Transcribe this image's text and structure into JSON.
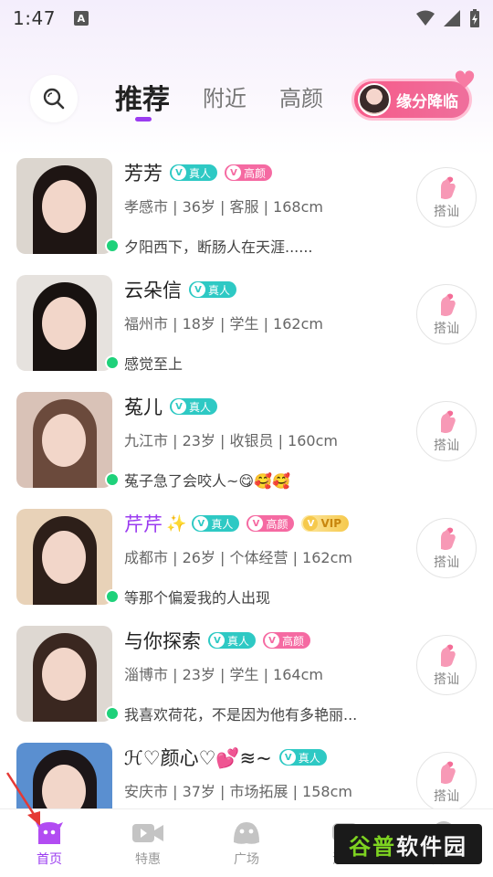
{
  "status_bar": {
    "time": "1:47",
    "notif_letter": "A"
  },
  "header": {
    "tabs": [
      {
        "label": "推荐",
        "active": true
      },
      {
        "label": "附近",
        "active": false
      },
      {
        "label": "高颜",
        "active": false
      }
    ],
    "fate_button": "缘分降临"
  },
  "badges": {
    "real": "真人",
    "beauty": "高颜",
    "vip": "VIP"
  },
  "greet_label": "搭讪",
  "users": [
    {
      "name": "芳芳",
      "real": true,
      "beauty": true,
      "vip": false,
      "info": "孝感市 | 36岁 | 客服 | 168cm",
      "motto": "夕阳西下，断肠人在天涯......",
      "online": true
    },
    {
      "name": "云朵信",
      "real": true,
      "beauty": false,
      "vip": false,
      "info": "福州市 | 18岁 | 学生 | 162cm",
      "motto": "感觉至上",
      "online": true
    },
    {
      "name": "菟儿",
      "real": true,
      "beauty": false,
      "vip": false,
      "info": "九江市 | 23岁 | 收银员 | 160cm",
      "motto": "菟子急了会咬人~😋🥰🥰",
      "online": true
    },
    {
      "name": "芹芹",
      "real": true,
      "beauty": true,
      "vip": true,
      "info": "成都市 | 26岁 | 个体经营 | 162cm",
      "motto": "等那个偏爱我的人出现",
      "online": true
    },
    {
      "name": "与你探索",
      "real": true,
      "beauty": true,
      "vip": false,
      "info": "淄博市 | 23岁 | 学生 | 164cm",
      "motto": "我喜欢荷花，不是因为他有多艳丽...",
      "online": true
    },
    {
      "name": "ℋ♡颜心♡💕≋~",
      "real": true,
      "beauty": false,
      "vip": false,
      "info": "安庆市 | 37岁 | 市场拓展 | 158cm",
      "motto": "",
      "online": false
    }
  ],
  "bottom_nav": [
    {
      "label": "首页",
      "icon": "home-ghost-icon",
      "active": true
    },
    {
      "label": "特惠",
      "icon": "video-camera-icon",
      "active": false
    },
    {
      "label": "广场",
      "icon": "plaza-ghost-icon",
      "active": false
    },
    {
      "label": "消息",
      "icon": "message-icon",
      "active": false
    },
    {
      "label": "我的",
      "icon": "profile-icon",
      "active": false
    }
  ],
  "watermark": {
    "part1": "谷普",
    "part2": "软件园"
  },
  "colors": {
    "accent": "#9b3cf0",
    "online": "#1ed17a",
    "real_badge": "#2ec9c4",
    "beauty_badge": "#f56aa2",
    "fate": "#f65b8a"
  }
}
